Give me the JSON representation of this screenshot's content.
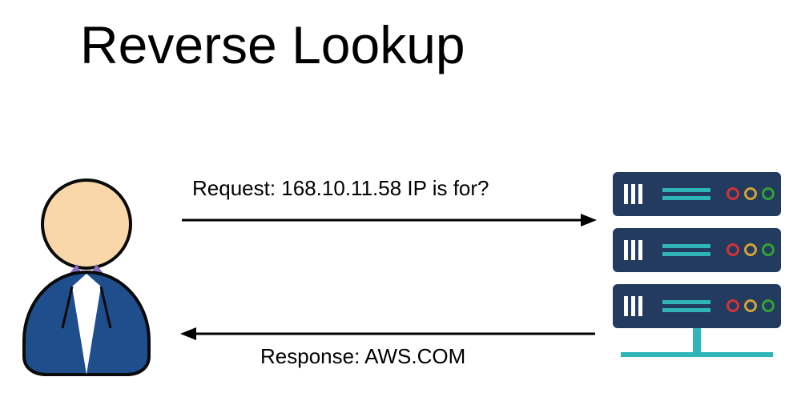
{
  "title": "Reverse Lookup",
  "request": {
    "label": "Request: 168.10.11.58 IP is for?"
  },
  "response": {
    "label": "Response: AWS.COM"
  },
  "colors": {
    "server_body": "#233b5e",
    "server_accent": "#2fb5b8",
    "led_red": "#d13434",
    "led_yellow": "#d1a234",
    "led_green": "#34a234",
    "user_suit": "#1e4e8c",
    "user_head": "#fad7a8",
    "user_collar": "#8a6cc4",
    "user_outline": "#0a0a0a"
  }
}
